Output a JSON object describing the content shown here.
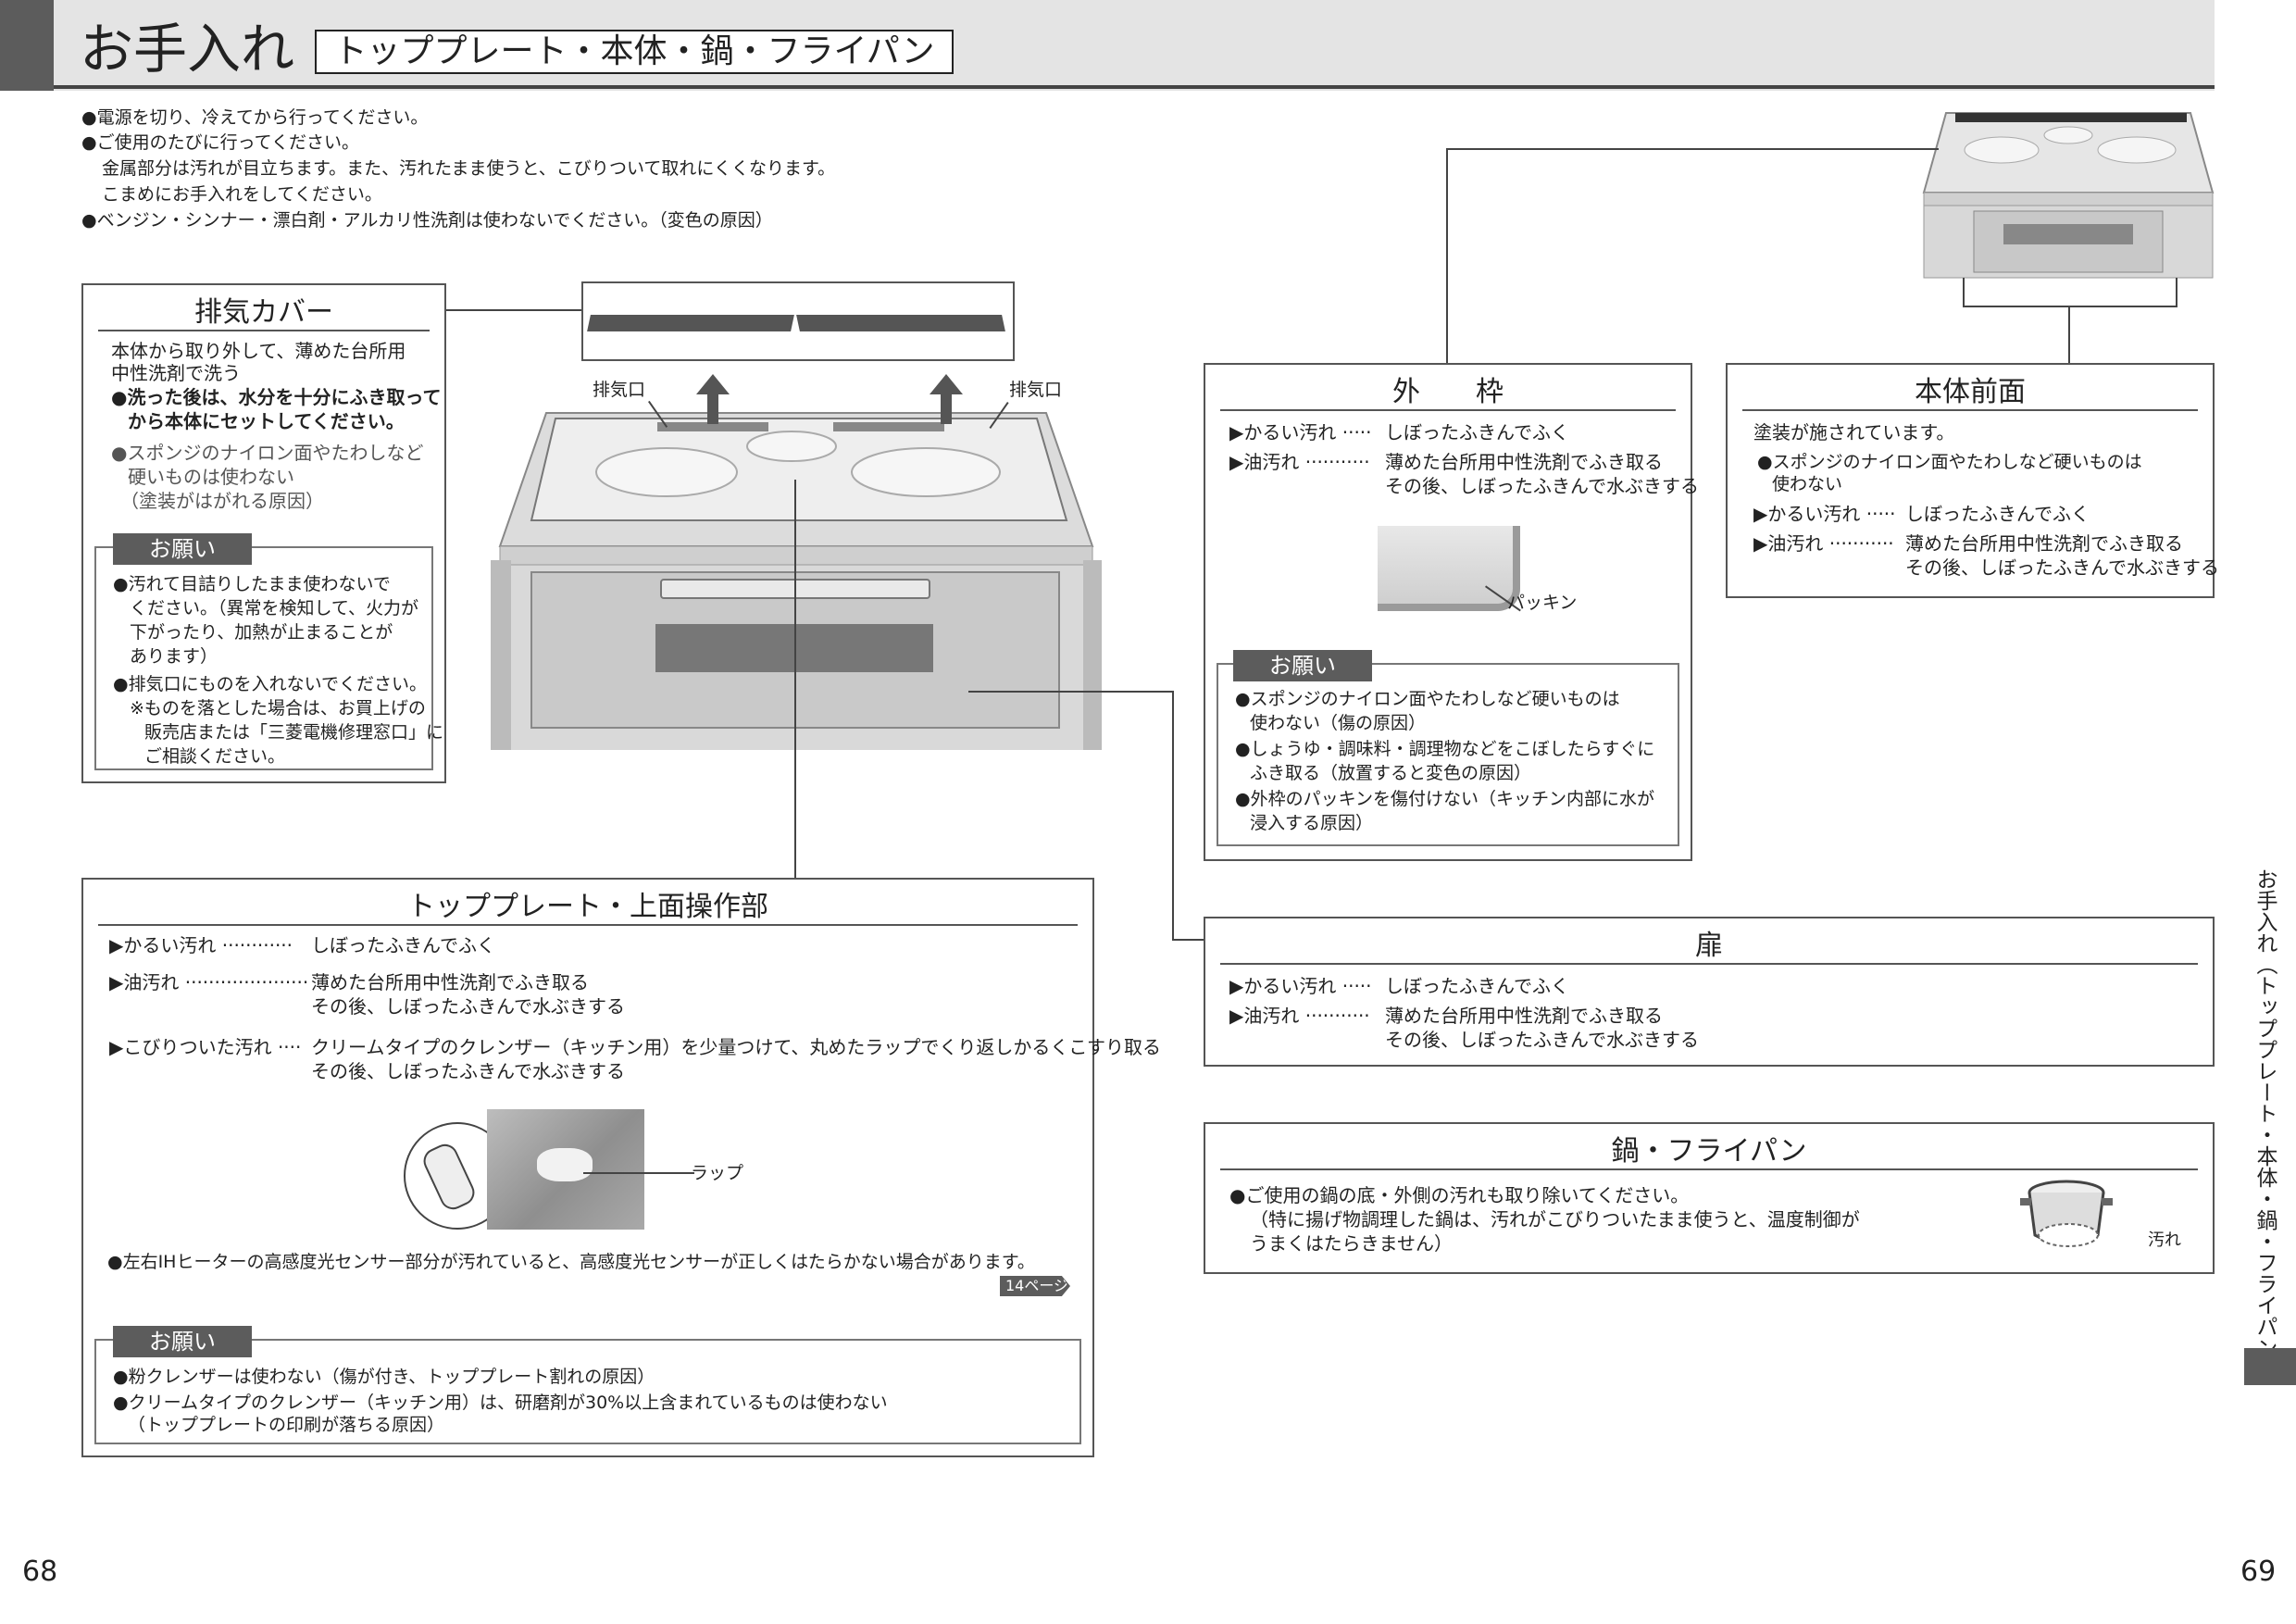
{
  "header": {
    "title": "お手入れ",
    "subtitle": "トッププレート・本体・鍋・フライパン"
  },
  "intro": [
    "●電源を切り、冷えてから行ってください。",
    "●ご使用のたびに行ってください。",
    "金属部分は汚れが目立ちます。また、汚れたまま使うと、こびりついて取れにくくなります。",
    "こまめにお手入れをしてください。",
    "●ベンジン・シンナー・漂白剤・アルカリ性洗剤は使わないでください。（変色の原因）"
  ],
  "haiki": {
    "title": "排気カバー",
    "l1": "本体から取り外して、薄めた台所用",
    "l2": "中性洗剤で洗う",
    "b1": "●洗った後は、水分を十分にふき取って",
    "b2": "から本体にセットしてください。",
    "n1": "●スポンジのナイロン面やたわしなど",
    "n2": "硬いものは使わない",
    "n3": "（塗装がはがれる原因）",
    "onegai": "お願い",
    "o1": "●汚れて目詰りしたまま使わないで",
    "o2": "ください。（異常を検知して、火力が",
    "o3": "下がったり、加熱が止まることが",
    "o4": "あります）",
    "o5": "●排気口にものを入れないでください。",
    "o6": "※ものを落とした場合は、お買上げの",
    "o7": "販売店または「三菱電機修理窓口」に",
    "o8": "ご相談ください。"
  },
  "exhaust_left": "排気口",
  "exhaust_right": "排気口",
  "top": {
    "title": "トッププレート・上面操作部",
    "r1k": "▶かるい汚れ ············",
    "r1v": "しぼったふきんでふく",
    "r2k": "▶油汚れ ·····················",
    "r2v1": "薄めた台所用中性洗剤でふき取る",
    "r2v2": "その後、しぼったふきんで水ぶきする",
    "r3k": "▶こびりついた汚れ ····",
    "r3v1": "クリームタイプのクレンザー（キッチン用）を少量つけて、丸めたラップでくり返しかるくこすり取る",
    "r3v2": "その後、しぼったふきんで水ぶきする",
    "wrap": "ラップ",
    "sensor": "●左右IHヒーターの高感度光センサー部分が汚れていると、高感度光センサーが正しくはたらかない場合があります。",
    "ref": "14ページ",
    "onegai": "お願い",
    "o1": "●粉クレンザーは使わない（傷が付き、トッププレート割れの原因）",
    "o2": "●クリームタイプのクレンザー（キッチン用）は、研磨剤が30%以上含まれているものは使わない",
    "o3": "（トッププレートの印刷が落ちる原因）"
  },
  "waku": {
    "title": "外　　枠",
    "r1k": "▶かるい汚れ ·····",
    "r1v": "しぼったふきんでふく",
    "r2k": "▶油汚れ ···········",
    "r2v1": "薄めた台所用中性洗剤でふき取る",
    "r2v2": "その後、しぼったふきんで水ぶきする",
    "packin": "パッキン",
    "onegai": "お願い",
    "o1": "●スポンジのナイロン面やたわしなど硬いものは",
    "o2": "使わない（傷の原因）",
    "o3": "●しょうゆ・調味料・調理物などをこぼしたらすぐに",
    "o4": "ふき取る（放置すると変色の原因）",
    "o5": "●外枠のパッキンを傷付けない（キッチン内部に水が",
    "o6": "浸入する原因）"
  },
  "front": {
    "title": "本体前面",
    "l1": "塗装が施されています。",
    "n1": "●スポンジのナイロン面やたわしなど硬いものは",
    "n2": "使わない",
    "r1k": "▶かるい汚れ ·····",
    "r1v": "しぼったふきんでふく",
    "r2k": "▶油汚れ ···········",
    "r2v1": "薄めた台所用中性洗剤でふき取る",
    "r2v2": "その後、しぼったふきんで水ぶきする"
  },
  "door": {
    "title": "扉",
    "r1k": "▶かるい汚れ ·····",
    "r1v": "しぼったふきんでふく",
    "r2k": "▶油汚れ ···········",
    "r2v1": "薄めた台所用中性洗剤でふき取る",
    "r2v2": "その後、しぼったふきんで水ぶきする"
  },
  "pan": {
    "title": "鍋・フライパン",
    "l1": "●ご使用の鍋の底・外側の汚れも取り除いてください。",
    "l2": "（特に揚げ物調理した鍋は、汚れがこびりついたまま使うと、温度制御が",
    "l3": "うまくはたらきません）",
    "dirt": "汚れ"
  },
  "side_label": "お手入れ（トッププレート・本体・鍋・フライパン）",
  "page_left": "68",
  "page_right": "69"
}
